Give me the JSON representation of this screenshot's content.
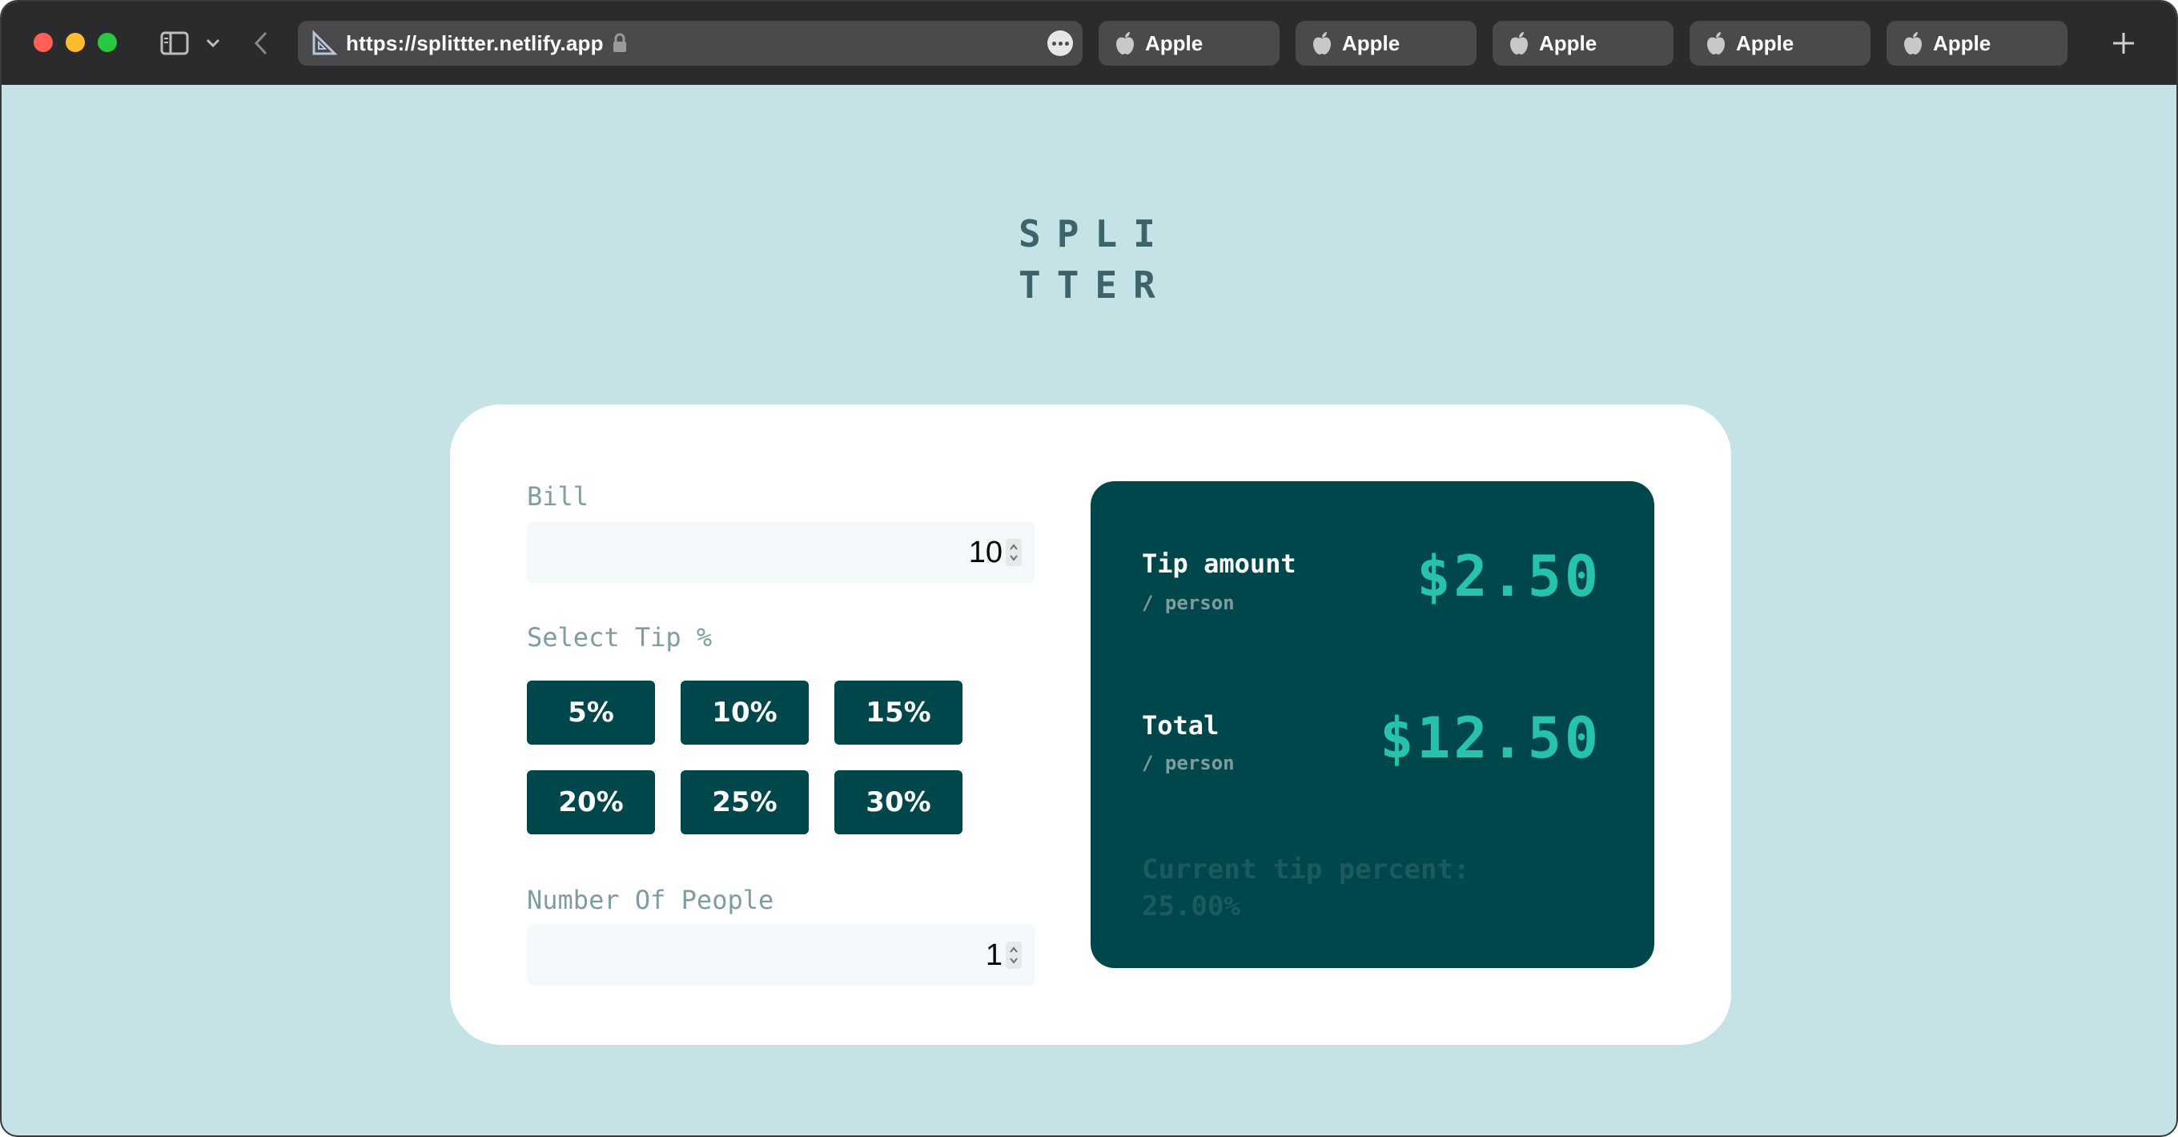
{
  "browser": {
    "url": "https://splittter.netlify.app",
    "tabs": [
      {
        "label": "Apple"
      },
      {
        "label": "Apple"
      },
      {
        "label": "Apple"
      },
      {
        "label": "Apple"
      },
      {
        "label": "Apple"
      }
    ],
    "icons": {
      "sidebar": "sidebar-icon",
      "chevron": "chevron-down-icon",
      "back": "back-arrow-icon",
      "site": "ruler-triangle-icon",
      "lock": "lock-icon",
      "more": "more-icon",
      "tab": "apple-icon",
      "new_tab": "plus-icon"
    }
  },
  "app": {
    "logo_line1": "SPLI",
    "logo_line2": "TTER",
    "bill": {
      "label": "Bill",
      "value": "10"
    },
    "tip": {
      "label": "Select Tip %",
      "options": [
        "5%",
        "10%",
        "15%",
        "20%",
        "25%",
        "30%"
      ]
    },
    "people": {
      "label": "Number Of People",
      "value": "1"
    },
    "result": {
      "tip_label": "Tip amount",
      "tip_sub": "/ person",
      "tip_value": "$2.50",
      "total_label": "Total",
      "total_sub": "/ person",
      "total_value": "$12.50",
      "current_tip_line1": "Current tip percent:",
      "current_tip_line2": "25.00%"
    }
  },
  "colors": {
    "page_bg": "#c5e3e6",
    "dark_cyan": "#00474b",
    "accent": "#26c2ae",
    "label_grey": "#7f9c9f"
  }
}
